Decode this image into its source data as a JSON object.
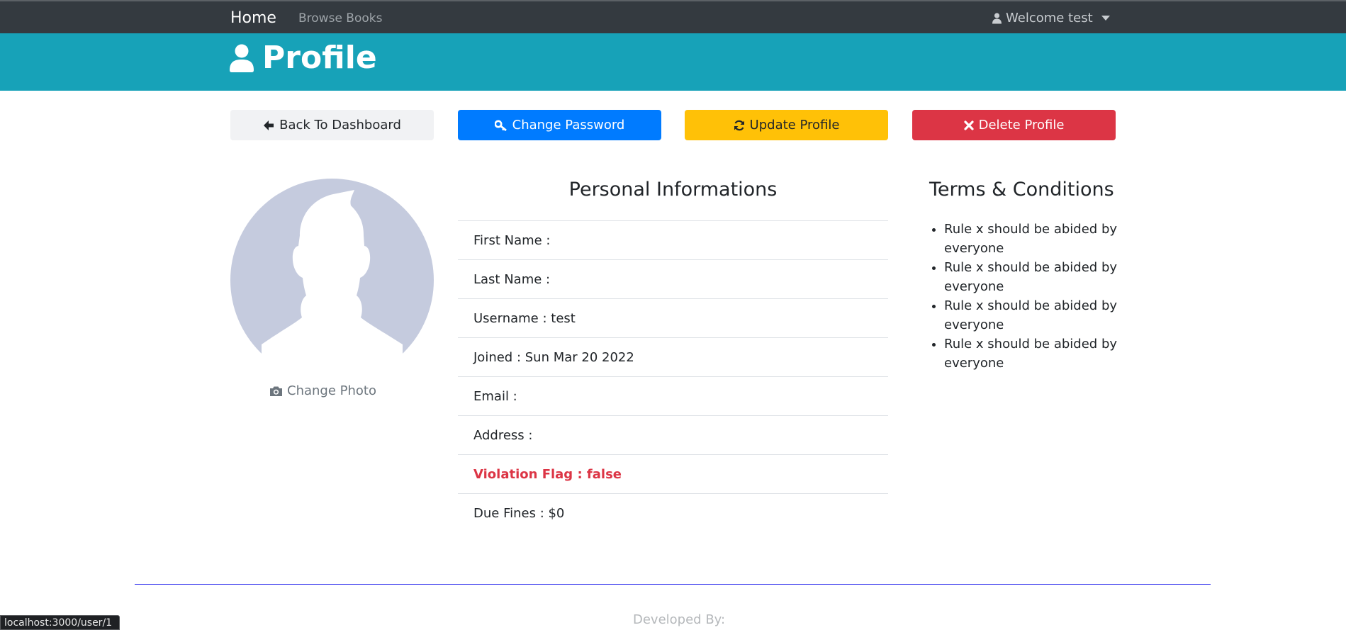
{
  "navbar": {
    "home_label": "Home",
    "browse_label": "Browse Books",
    "welcome_label": "Welcome test"
  },
  "hero": {
    "title": "Profile"
  },
  "actions": {
    "back_label": "Back To Dashboard",
    "password_label": "Change Password",
    "update_label": "Update Profile",
    "delete_label": "Delete Profile"
  },
  "avatar": {
    "change_photo_label": "Change Photo"
  },
  "personal": {
    "title": "Personal Informations",
    "rows": [
      "First Name : ",
      "Last Name : ",
      "Username : test",
      "Joined : Sun Mar 20 2022",
      "Email : ",
      "Address : ",
      "Violation Flag : false",
      "Due Fines : $0"
    ]
  },
  "terms": {
    "title": "Terms & Conditions",
    "items": [
      "Rule x should be abided by everyone",
      "Rule x should be abided by everyone",
      "Rule x should be abided by everyone",
      "Rule x should be abided by everyone"
    ]
  },
  "footer": {
    "developed_by": "Developed By:"
  },
  "status_bar": {
    "url": "localhost:3000/user/1"
  },
  "colors": {
    "navbar": "#343a40",
    "hero": "#17a2b8",
    "primary": "#007bff",
    "warning": "#ffc107",
    "danger": "#dc3545",
    "light": "#f1f2f4"
  }
}
